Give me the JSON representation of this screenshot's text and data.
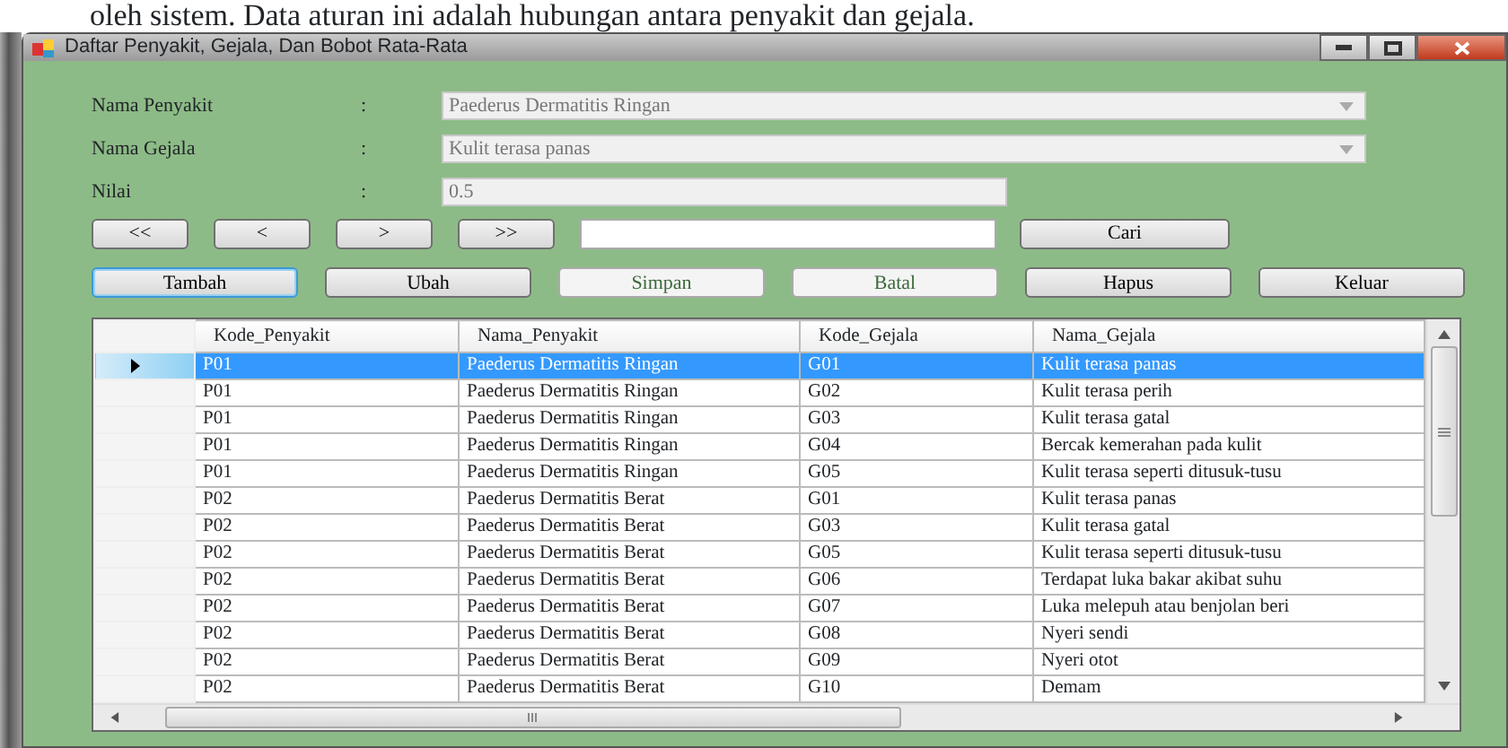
{
  "document_text": "oleh sistem. Data aturan ini adalah hubungan antara penyakit dan gejala.",
  "window": {
    "title": "Daftar Penyakit, Gejala, Dan Bobot Rata-Rata"
  },
  "fields": [
    {
      "label": "Nama Penyakit",
      "separator": ":",
      "value": "Paederus Dermatitis Ringan",
      "kind": "combo",
      "disabled": true
    },
    {
      "label": "Nama Gejala",
      "separator": ":",
      "value": "Kulit terasa panas",
      "kind": "combo",
      "disabled": true
    },
    {
      "label": "Nilai",
      "separator": ":",
      "value": "0.5",
      "kind": "text",
      "disabled": true
    }
  ],
  "nav_buttons": [
    "<<",
    "<",
    ">",
    ">>"
  ],
  "search_button": "Cari",
  "action_buttons": [
    {
      "label": "Tambah",
      "disabled": false,
      "focused": true
    },
    {
      "label": "Ubah",
      "disabled": false,
      "focused": false
    },
    {
      "label": "Simpan",
      "disabled": true,
      "focused": false
    },
    {
      "label": "Batal",
      "disabled": true,
      "focused": false
    },
    {
      "label": "Hapus",
      "disabled": false,
      "focused": false
    },
    {
      "label": "Keluar",
      "disabled": false,
      "focused": false
    }
  ],
  "grid": {
    "columns": [
      "Kode_Penyakit",
      "Nama_Penyakit",
      "Kode_Gejala",
      "Nama_Gejala"
    ],
    "rows": [
      {
        "cells": [
          "P01",
          "Paederus Dermatitis Ringan",
          "G01",
          "Kulit terasa panas"
        ],
        "selected": true
      },
      {
        "cells": [
          "P01",
          "Paederus Dermatitis Ringan",
          "G02",
          "Kulit terasa perih"
        ],
        "selected": false
      },
      {
        "cells": [
          "P01",
          "Paederus Dermatitis Ringan",
          "G03",
          "Kulit terasa gatal"
        ],
        "selected": false
      },
      {
        "cells": [
          "P01",
          "Paederus Dermatitis Ringan",
          "G04",
          "Bercak kemerahan pada kulit"
        ],
        "selected": false
      },
      {
        "cells": [
          "P01",
          "Paederus Dermatitis Ringan",
          "G05",
          "Kulit terasa seperti ditusuk-tusu"
        ],
        "selected": false
      },
      {
        "cells": [
          "P02",
          "Paederus Dermatitis Berat",
          "G01",
          "Kulit terasa panas"
        ],
        "selected": false
      },
      {
        "cells": [
          "P02",
          "Paederus Dermatitis Berat",
          "G03",
          "Kulit terasa gatal"
        ],
        "selected": false
      },
      {
        "cells": [
          "P02",
          "Paederus Dermatitis Berat",
          "G05",
          "Kulit terasa seperti ditusuk-tusu"
        ],
        "selected": false
      },
      {
        "cells": [
          "P02",
          "Paederus Dermatitis Berat",
          "G06",
          "Terdapat luka bakar akibat suhu"
        ],
        "selected": false
      },
      {
        "cells": [
          "P02",
          "Paederus Dermatitis Berat",
          "G07",
          "Luka melepuh atau benjolan beri"
        ],
        "selected": false
      },
      {
        "cells": [
          "P02",
          "Paederus Dermatitis Berat",
          "G08",
          "Nyeri sendi"
        ],
        "selected": false
      },
      {
        "cells": [
          "P02",
          "Paederus Dermatitis Berat",
          "G09",
          "Nyeri otot"
        ],
        "selected": false
      },
      {
        "cells": [
          "P02",
          "Paederus Dermatitis Berat",
          "G10",
          "Demam"
        ],
        "selected": false
      }
    ]
  }
}
